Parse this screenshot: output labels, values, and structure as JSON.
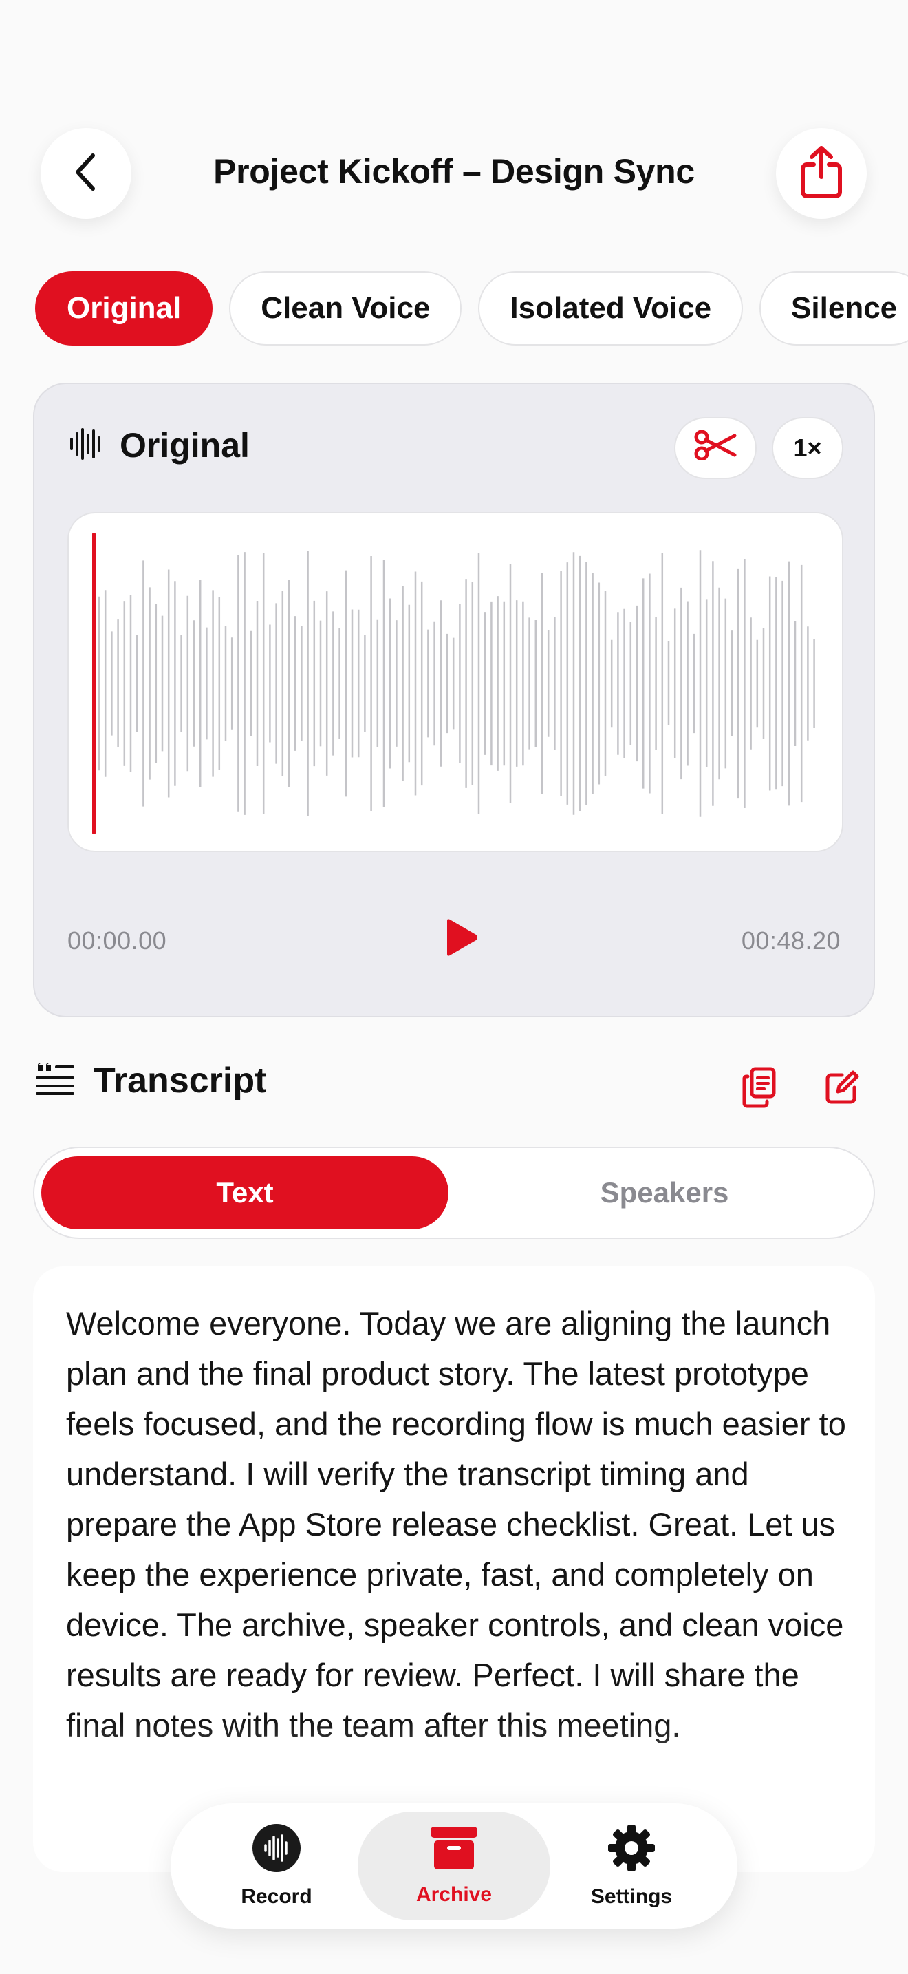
{
  "colors": {
    "accent": "#e01020",
    "background": "#fafafa",
    "muted": "#8a8a90"
  },
  "header": {
    "title": "Project Kickoff – Design Sync",
    "back_icon": "chevron-left-icon",
    "share_icon": "share-icon"
  },
  "tabs": [
    {
      "label": "Original",
      "active": true
    },
    {
      "label": "Clean Voice",
      "active": false
    },
    {
      "label": "Isolated Voice",
      "active": false
    },
    {
      "label": "Silence",
      "active": false
    }
  ],
  "player": {
    "title": "Original",
    "speed": "1×",
    "time_start": "00:00.00",
    "time_end": "00:48.20",
    "progress": 0
  },
  "transcript": {
    "title": "Transcript",
    "segments": {
      "text": "Text",
      "speakers": "Speakers",
      "selected": "Text"
    },
    "body": "Welcome everyone. Today we are aligning the launch plan and the final product story. The latest prototype feels focused, and the recording flow is much easier to understand. I will verify the transcript timing and prepare the App Store release checklist. Great. Let us keep the experience private, fast, and completely on device. The archive, speaker controls, and clean voice results are ready for review. Perfect. I will share the final notes with the team after this meeting."
  },
  "nav": {
    "record": "Record",
    "archive": "Archive",
    "settings": "Settings",
    "active": "Archive"
  }
}
